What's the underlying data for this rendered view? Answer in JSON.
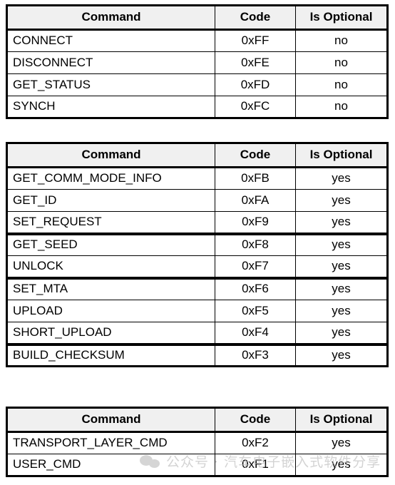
{
  "document": {
    "kind": "xcp-ccp-command-reference-tables",
    "columns": [
      "Command",
      "Code",
      "Is Optional"
    ]
  },
  "tables": [
    {
      "id": "table-1",
      "name": "standard-commands",
      "headers": {
        "command": "Command",
        "code": "Code",
        "optional": "Is Optional"
      },
      "groups": [
        {
          "rows": [
            {
              "command": "CONNECT",
              "code": "0xFF",
              "optional": "no"
            },
            {
              "command": "DISCONNECT",
              "code": "0xFE",
              "optional": "no"
            },
            {
              "command": "GET_STATUS",
              "code": "0xFD",
              "optional": "no"
            },
            {
              "command": "SYNCH",
              "code": "0xFC",
              "optional": "no"
            }
          ]
        }
      ]
    },
    {
      "id": "table-2",
      "name": "optional-commands",
      "headers": {
        "command": "Command",
        "code": "Code",
        "optional": "Is Optional"
      },
      "groups": [
        {
          "rows": [
            {
              "command": "GET_COMM_MODE_INFO",
              "code": "0xFB",
              "optional": "yes"
            },
            {
              "command": "GET_ID",
              "code": "0xFA",
              "optional": "yes"
            },
            {
              "command": "SET_REQUEST",
              "code": "0xF9",
              "optional": "yes"
            }
          ]
        },
        {
          "rows": [
            {
              "command": "GET_SEED",
              "code": "0xF8",
              "optional": "yes"
            },
            {
              "command": "UNLOCK",
              "code": "0xF7",
              "optional": "yes"
            }
          ]
        },
        {
          "rows": [
            {
              "command": "SET_MTA",
              "code": "0xF6",
              "optional": "yes"
            },
            {
              "command": "UPLOAD",
              "code": "0xF5",
              "optional": "yes"
            },
            {
              "command": "SHORT_UPLOAD",
              "code": "0xF4",
              "optional": "yes"
            }
          ]
        },
        {
          "rows": [
            {
              "command": "BUILD_CHECKSUM",
              "code": "0xF3",
              "optional": "yes"
            }
          ]
        }
      ]
    },
    {
      "id": "table-3",
      "name": "user-and-transport-commands",
      "headers": {
        "command": "Command",
        "code": "Code",
        "optional": "Is Optional"
      },
      "groups": [
        {
          "rows": [
            {
              "command": "TRANSPORT_LAYER_CMD",
              "code": "0xF2",
              "optional": "yes"
            },
            {
              "command": "USER_CMD",
              "code": "0xF1",
              "optional": "yes"
            }
          ]
        }
      ]
    }
  ],
  "watermark": {
    "icon": "wechat-logo-icon",
    "text": "公众号 · 汽车电子嵌入式软件分享",
    "color": "#b9b9b9"
  },
  "colors": {
    "header_background": "#f0f0f0",
    "cell_background": "#ffffff",
    "border": "#000000",
    "text": "#000000"
  }
}
